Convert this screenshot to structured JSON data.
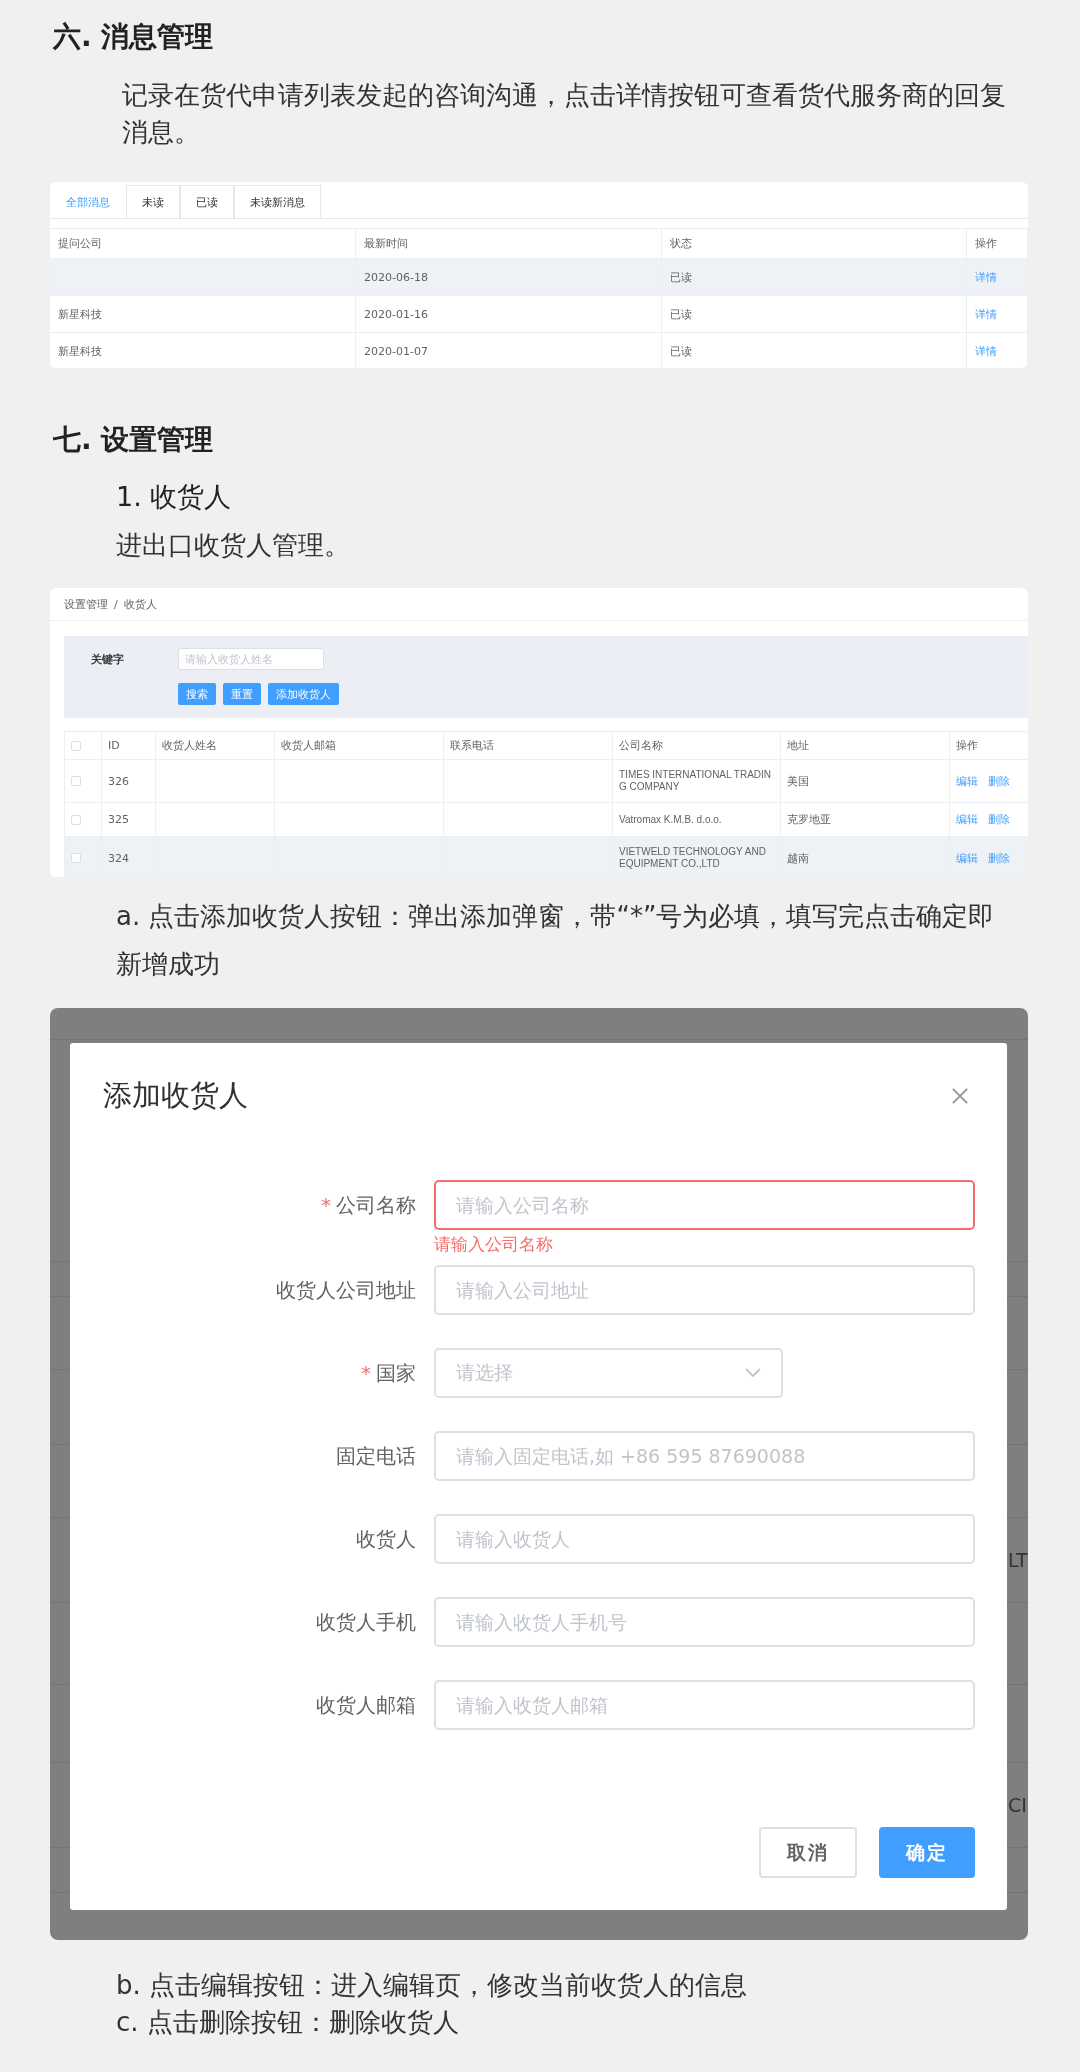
{
  "heading_messages": "六. 消息管理",
  "intro_messages": "记录在货代申请列表发起的咨询沟通，点击详情按钮可查看货代服务商的回复消息。",
  "messages_screenshot": {
    "tabs": [
      {
        "label": "全部消息",
        "selected": true
      },
      {
        "label": "未读",
        "selected": false
      },
      {
        "label": "已读",
        "selected": false
      },
      {
        "label": "未读新消息",
        "selected": false
      }
    ],
    "columns": [
      "提问公司",
      "最新时间",
      "状态",
      "操作"
    ],
    "rows": [
      {
        "time": "2020-06-18",
        "status": "已读",
        "action": "详情",
        "hovered": true
      },
      {
        "company": "新星科技",
        "time": "2020-01-16",
        "status": "已读",
        "action": "详情",
        "hovered": false
      },
      {
        "company": "新星科技",
        "time": "2020-01-07",
        "status": "已读",
        "action": "详情",
        "hovered": false
      }
    ]
  },
  "heading_settings": "七. 设置管理",
  "subheading": "1. 收货人",
  "sub_intro": "进出口收货人管理。",
  "consignee_screenshot": {
    "breadcrumb": [
      "设置管理",
      "收货人"
    ],
    "breadcrumb_separator": "/",
    "search": {
      "label": "关键字",
      "placeholder": "请输入收货人姓名"
    },
    "buttons": [
      "搜索",
      "重置",
      "添加收货人"
    ],
    "all_checked": false,
    "columns": [
      "ID",
      "收货人姓名",
      "收货人邮箱",
      "联系电话",
      "公司名称",
      "地址",
      "操作"
    ],
    "rows": [
      {
        "checked": false,
        "id": "326",
        "company": "TIMES INTERNATIONAL TRADING COMPANY",
        "address": "美国",
        "actions": [
          "编辑",
          "删除"
        ],
        "hovered": false
      },
      {
        "checked": false,
        "id": "325",
        "company": "Vatromax K.M.B. d.o.o.",
        "address": "克罗地亚",
        "actions": [
          "编辑",
          "删除"
        ],
        "hovered": false
      },
      {
        "checked": false,
        "id": "324",
        "company": "VIETWELD TECHNOLOGY AND EQUIPMENT CO.,LTD",
        "address": "越南",
        "actions": [
          "编辑",
          "删除"
        ],
        "hovered": true
      }
    ]
  },
  "step_a": "a. 点击添加收货人按钮：弹出添加弹窗，带“*”号为必填，填写完点击确定即新增成功",
  "dialog_screenshot": {
    "backdrop_fragments": [
      "LT",
      "CI"
    ],
    "dialog": {
      "title": "添加收货人",
      "required_mark": "*",
      "fields": [
        {
          "label": "公司名称",
          "required": true,
          "kind": "input",
          "placeholder": "请输入公司名称",
          "error": "请输入公司名称"
        },
        {
          "label": "收货人公司地址",
          "required": false,
          "kind": "input",
          "placeholder": "请输入公司地址"
        },
        {
          "label": "国家",
          "required": true,
          "kind": "select",
          "placeholder": "请选择"
        },
        {
          "label": "固定电话",
          "required": false,
          "kind": "input",
          "placeholder": "请输入固定电话,如 +86 595 87690088"
        },
        {
          "label": "收货人",
          "required": false,
          "kind": "input",
          "placeholder": "请输入收货人"
        },
        {
          "label": "收货人手机",
          "required": false,
          "kind": "input",
          "placeholder": "请输入收货人手机号"
        },
        {
          "label": "收货人邮箱",
          "required": false,
          "kind": "input",
          "placeholder": "请输入收货人邮箱"
        }
      ],
      "buttons": [
        {
          "label": "取消",
          "primary": false
        },
        {
          "label": "确定",
          "primary": true
        }
      ]
    }
  },
  "step_b": "b. 点击编辑按钮：进入编辑页，修改当前收货人的信息",
  "step_c": "c. 点击删除按钮：删除收货人"
}
